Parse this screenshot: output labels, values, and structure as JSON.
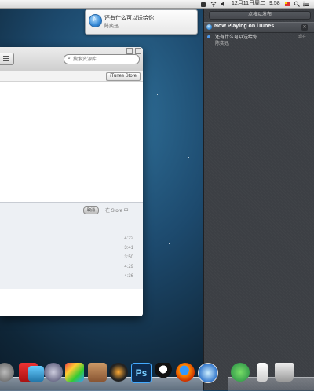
{
  "menubar": {
    "date": "12月11日周二",
    "time": "9:58",
    "icons": [
      "bag-icon",
      "wifi-icon",
      "sound-icon",
      "flag-icon",
      "search-icon",
      "notification-center-icon"
    ]
  },
  "banner": {
    "app_icon": "itunes-icon",
    "song": "还有什么可以送给你",
    "artist": "陈奕迅"
  },
  "itunes_window": {
    "search_placeholder": "搜索资源库",
    "store_button": "iTunes Store",
    "cancel_button": "取消",
    "in_store_label": "在 Store 中",
    "durations": [
      "4:22",
      "3:41",
      "3:50",
      "4:29",
      "4:36"
    ]
  },
  "notification_center": {
    "share_label": "点按以发布",
    "section_title": "Now Playing on iTunes",
    "close_symbol": "✕",
    "item": {
      "song": "还有什么可以送给你",
      "artist": "陈奕迅",
      "time": "现在"
    }
  },
  "dock": {
    "apps": [
      "system-preferences-icon",
      "photo-booth-icon",
      "preview-icon",
      "pen-tool-icon",
      "dashboard-icon",
      "keynote-icon",
      "aperture-icon",
      "photoshop-icon",
      "qq-icon",
      "firefox-icon",
      "safari-icon",
      "utility-icon",
      "file-icon",
      "trash-icon"
    ],
    "photoshop_label": "Ps"
  }
}
